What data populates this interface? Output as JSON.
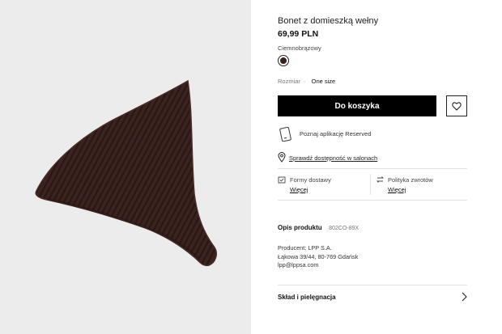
{
  "product": {
    "title": "Bonet z domieszką wełny",
    "price": "69,99 PLN",
    "image_icon": "hat-photo"
  },
  "color": {
    "label": "Ciemnobrązowy",
    "swatch_hex": "#3a1f1c"
  },
  "size": {
    "label": "Rozmiar",
    "separator": "·",
    "value": "One size"
  },
  "actions": {
    "cart_label": "Do koszyka",
    "wishlist_icon": "heart-icon"
  },
  "app_promo": {
    "text": "Poznaj aplikację Reserved",
    "icon": "phone-icon"
  },
  "store_check": {
    "text": "Sprawdź dostępność w salonach",
    "icon": "location-pin-icon"
  },
  "delivery": {
    "label": "Formy dostawy",
    "link": "Więcej",
    "icon": "box-check-icon"
  },
  "returns": {
    "label": "Polityka zwrotów",
    "link": "Więcej",
    "icon": "return-arrows-icon"
  },
  "description": {
    "heading": "Opis produktu",
    "code": "802CO-89X"
  },
  "producer": {
    "line1": "Producent: LPP S.A.",
    "line2": "Łąkowa 39/44, 80-769 Gdańsk",
    "line3": "lpp@lppsa.com"
  },
  "care": {
    "label": "Skład i pielęgnacja",
    "icon": "chevron-right-icon"
  },
  "colors": {
    "button_bg": "#000000",
    "gallery_bg": "#ececec",
    "hat": "#3a221f"
  }
}
